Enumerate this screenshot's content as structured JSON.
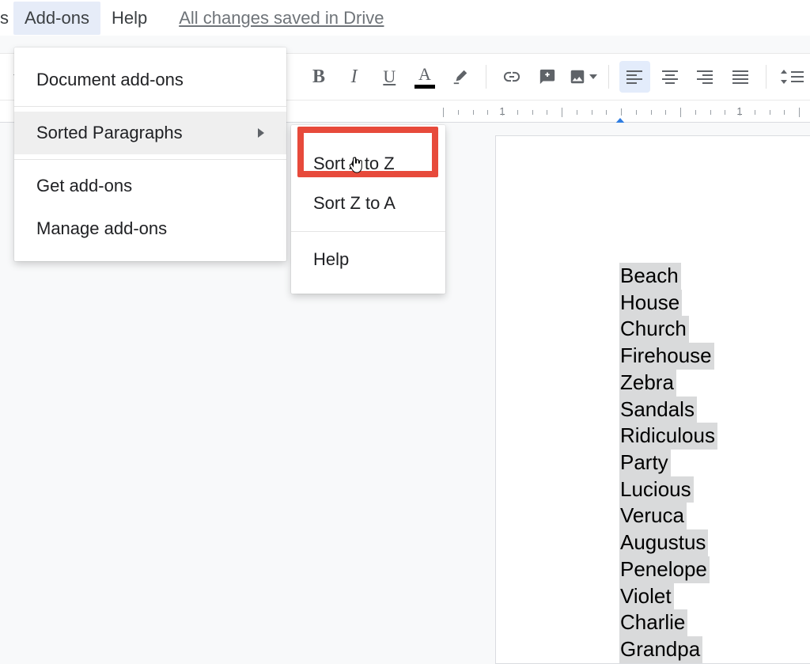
{
  "menubar": {
    "stub": "s",
    "addons": "Add-ons",
    "help": "Help",
    "save_status": "All changes saved in Drive"
  },
  "toolbar": {
    "bold": "B",
    "italic": "I",
    "underline": "U",
    "textcolor": "A"
  },
  "ruler": {
    "label_1a": "1",
    "label_1b": "1"
  },
  "addons_menu": {
    "document_addons": "Document add-ons",
    "sorted_paragraphs": "Sorted Paragraphs",
    "get_addons": "Get add-ons",
    "manage_addons": "Manage add-ons"
  },
  "sorted_submenu": {
    "sort_az": "Sort A to Z",
    "sort_za": "Sort Z to A",
    "help": "Help"
  },
  "document": {
    "words": [
      "Beach",
      "House",
      "Church",
      "Firehouse",
      "Zebra",
      "Sandals",
      "Ridiculous",
      "Party",
      "Lucious",
      "Veruca",
      "Augustus",
      "Penelope",
      "Violet",
      "Charlie",
      "Grandpa"
    ]
  }
}
